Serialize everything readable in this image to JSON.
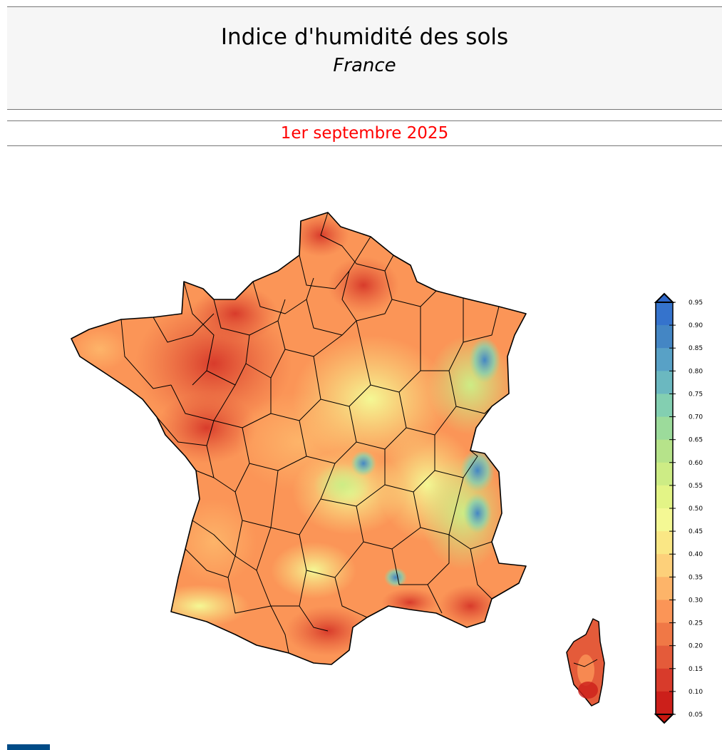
{
  "header": {
    "title": "Indice d'humidité des sols",
    "subtitle": "France"
  },
  "date": {
    "label": "1er septembre 2025",
    "color": "#ff0000"
  },
  "colorbar": {
    "ticks": [
      "0.95",
      "0.90",
      "0.85",
      "0.80",
      "0.75",
      "0.70",
      "0.65",
      "0.60",
      "0.55",
      "0.50",
      "0.45",
      "0.40",
      "0.35",
      "0.30",
      "0.25",
      "0.20",
      "0.15",
      "0.10",
      "0.05"
    ],
    "colors": [
      "#3573cc",
      "#4486c4",
      "#58a1c6",
      "#6bb8c0",
      "#83cfb1",
      "#9cdb9b",
      "#b6e38a",
      "#cdec85",
      "#e3f486",
      "#f4f894",
      "#fae785",
      "#fdd07a",
      "#fdb469",
      "#fb9557",
      "#f07846",
      "#e45b3a",
      "#d83b2b",
      "#cc1f1a"
    ],
    "over_color": "#2f67c8",
    "under_color": "#c8170f"
  },
  "brand": {
    "color": "#004b87"
  }
}
